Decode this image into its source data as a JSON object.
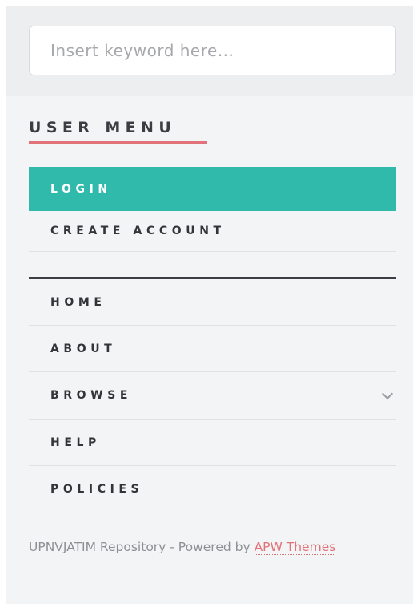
{
  "search": {
    "placeholder": "Insert keyword here..."
  },
  "user_menu": {
    "title": "USER MENU",
    "items": [
      {
        "label": "LOGIN",
        "active": true
      },
      {
        "label": "CREATE ACCOUNT",
        "active": false
      }
    ]
  },
  "main_menu": {
    "items": [
      {
        "label": "HOME"
      },
      {
        "label": "ABOUT"
      },
      {
        "label": "BROWSE",
        "icon": "chevron-down-icon"
      },
      {
        "label": "HELP"
      },
      {
        "label": "POLICIES"
      }
    ]
  },
  "footer": {
    "text": "UPNVJATIM Repository - Powered by ",
    "link_label": "APW Themes"
  },
  "colors": {
    "accent": "#2fbaab",
    "underline": "#e2727a",
    "link": "#e2727a",
    "text_dark": "#333438",
    "background": "#f3f4f5"
  }
}
